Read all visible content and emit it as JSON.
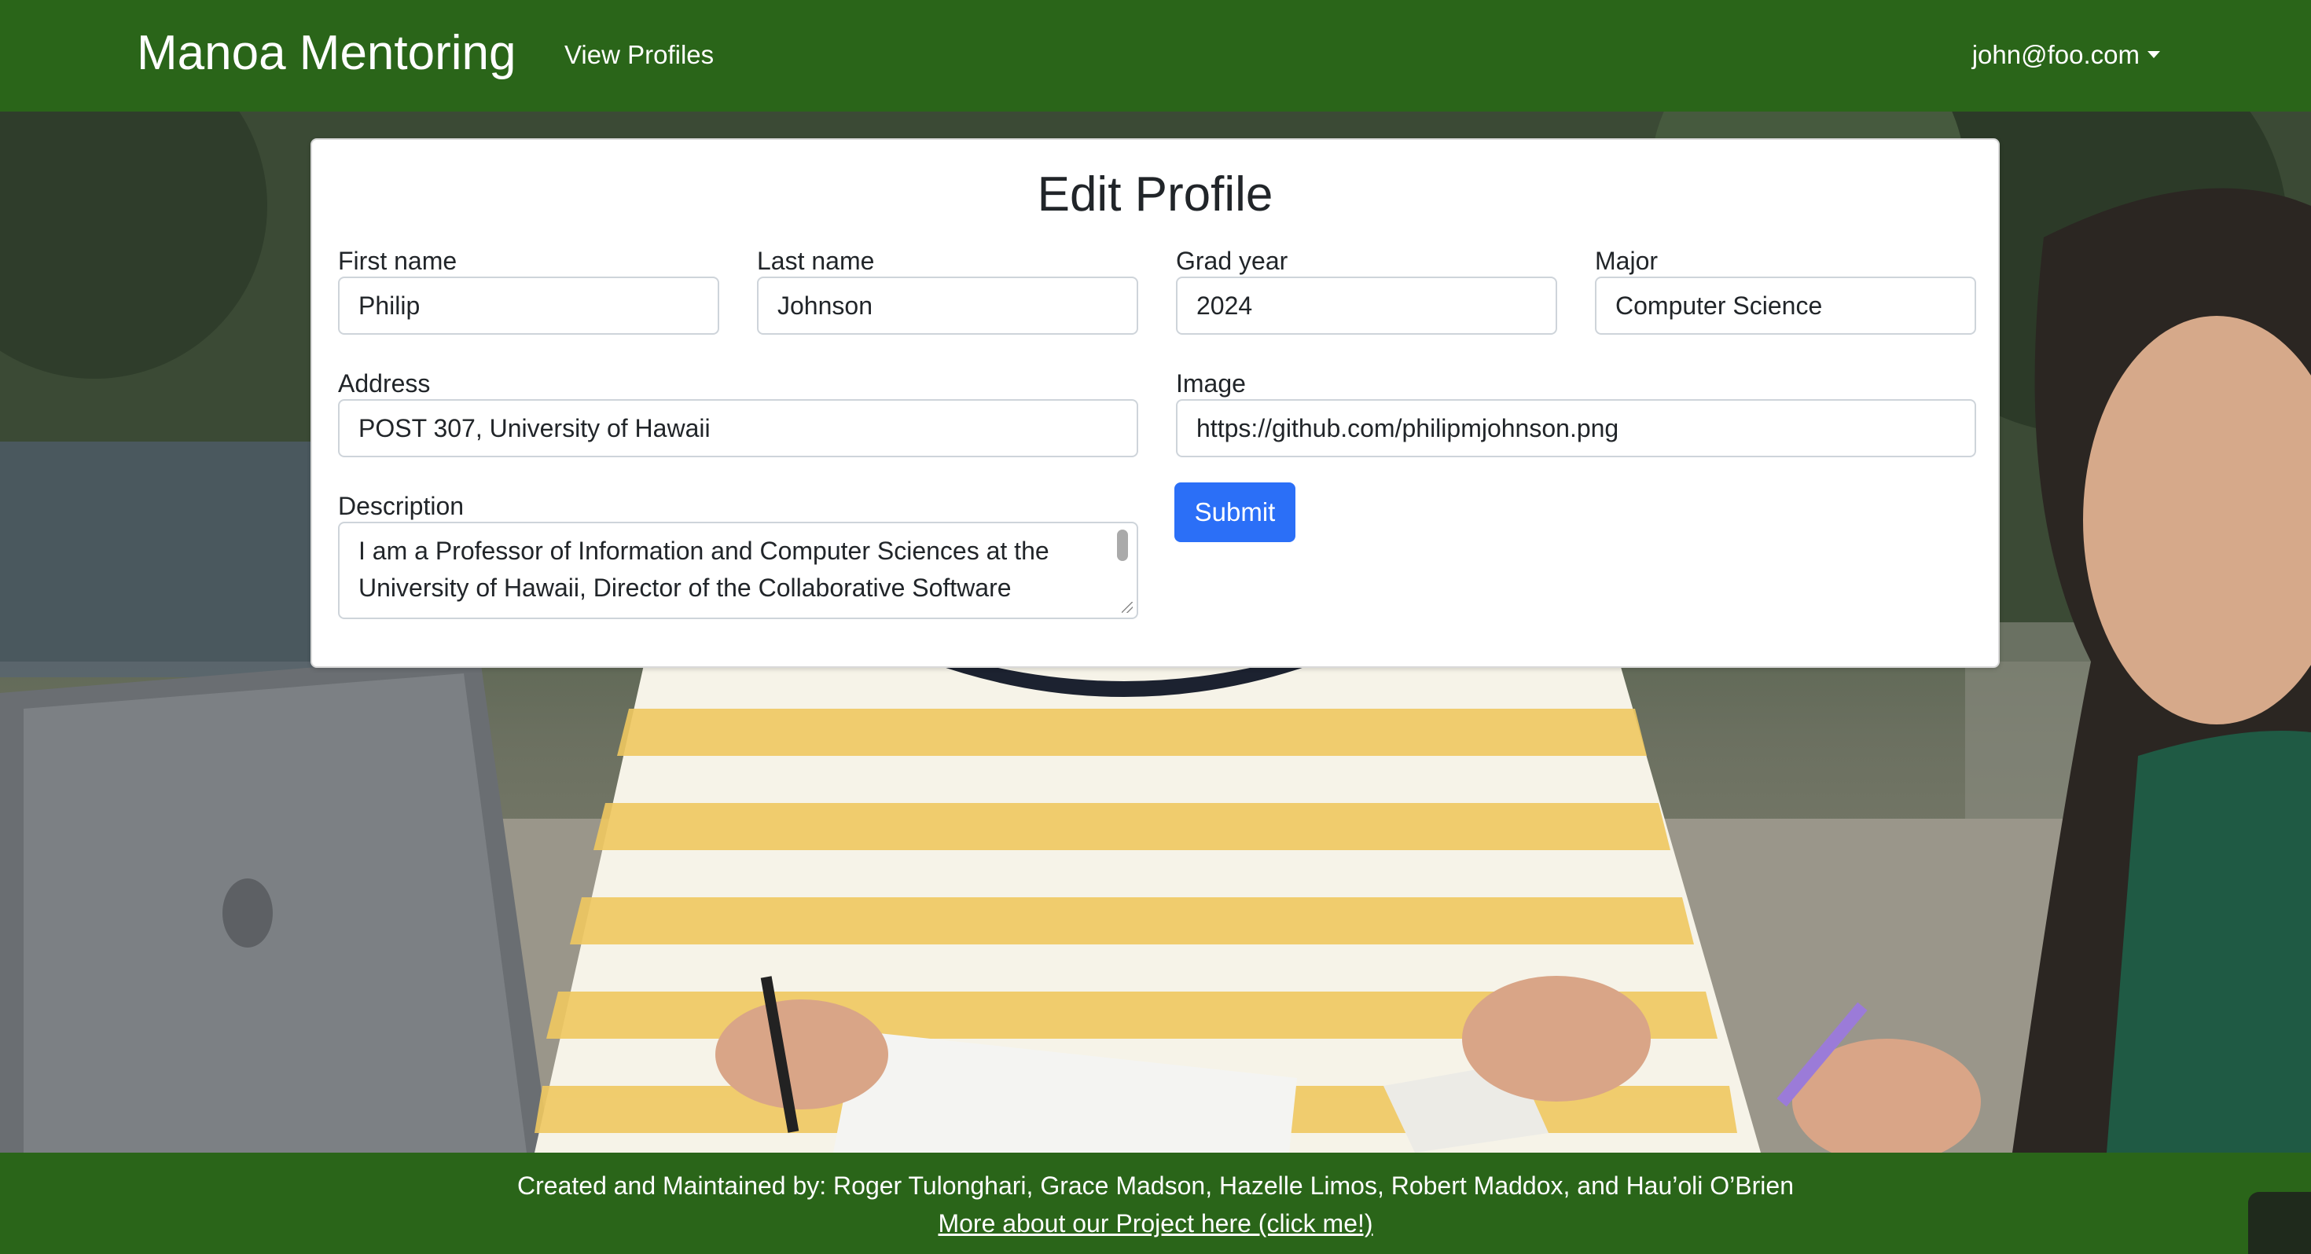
{
  "navbar": {
    "brand": "Manoa Mentoring",
    "view_profiles": "View Profiles",
    "user_email": "john@foo.com"
  },
  "form": {
    "title": "Edit Profile",
    "first_name": {
      "label": "First name",
      "value": "Philip"
    },
    "last_name": {
      "label": "Last name",
      "value": "Johnson"
    },
    "grad_year": {
      "label": "Grad year",
      "value": "2024"
    },
    "major": {
      "label": "Major",
      "value": "Computer Science"
    },
    "address": {
      "label": "Address",
      "value": "POST 307, University of Hawaii"
    },
    "image": {
      "label": "Image",
      "value": "https://github.com/philipmjohnson.png"
    },
    "description": {
      "label": "Description",
      "value": "I am a Professor of Information and Computer Sciences at the University of Hawaii, Director of the Collaborative Software"
    },
    "submit_label": "Submit"
  },
  "footer": {
    "credit": "Created and Maintained by: Roger Tulonghari, Grace Madson, Hazelle Limos, Robert Maddox, and Hau’oli O’Brien",
    "project_link": "More about our Project here (click me!)"
  },
  "colors": {
    "navbar_bg": "#2a6519",
    "submit_bg": "#2b6ff7",
    "card_bg": "#ffffff"
  }
}
